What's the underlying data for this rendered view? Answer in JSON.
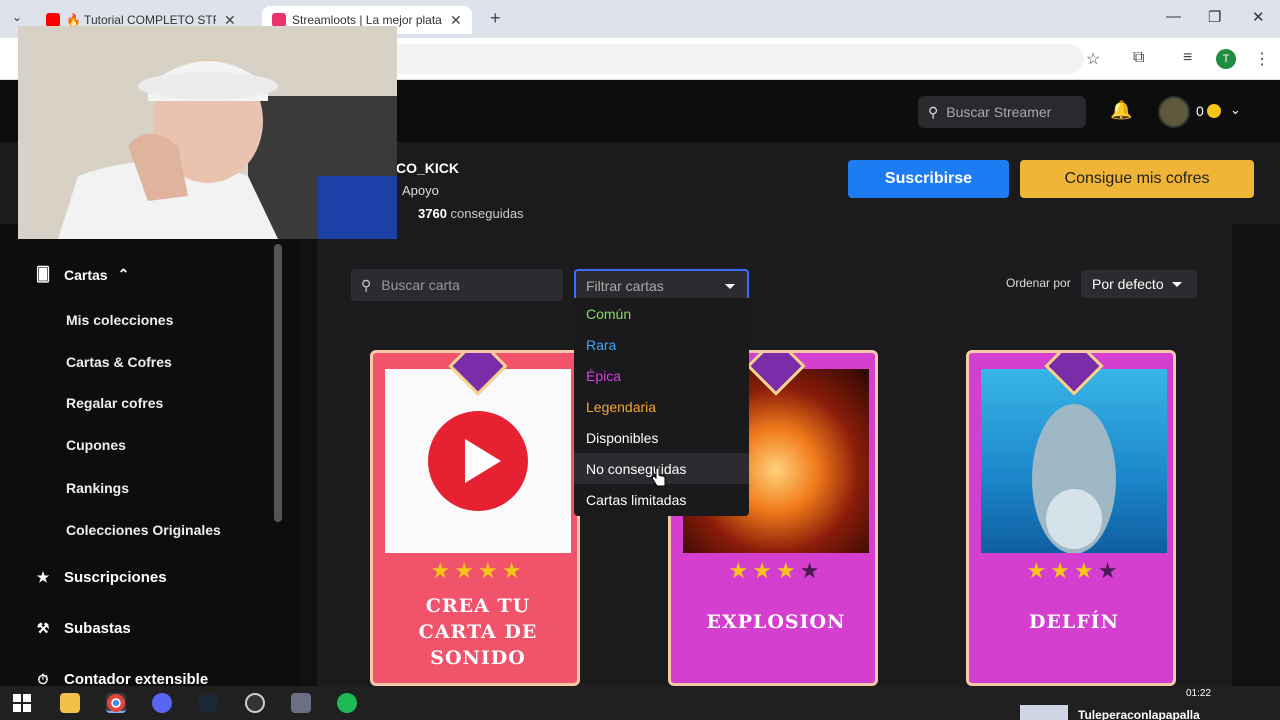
{
  "browser": {
    "tabs": [
      {
        "title": "🔥 Tutorial COMPLETO STREAM",
        "active": false
      },
      {
        "title": "Streamloots | La mejor plataform",
        "active": true
      }
    ]
  },
  "topnav": {
    "search_placeholder": "Buscar Streamer",
    "coins": "0"
  },
  "hero": {
    "name": "CO_KICK",
    "role": "Apoyo",
    "count": "3760",
    "count_suffix": "conseguidas",
    "subscribe_label": "Suscribirse",
    "chests_label": "Consigue mis cofres"
  },
  "sidebar": {
    "cards_section": "Cartas",
    "sub_items": [
      "Mis colecciones",
      "Cartas & Cofres",
      "Regalar cofres",
      "Cupones",
      "Rankings",
      "Colecciones Originales"
    ],
    "subscriptions": "Suscripciones",
    "auctions": "Subastas",
    "extensible_counter": "Contador extensible"
  },
  "toolbar": {
    "card_search_placeholder": "Buscar carta",
    "filter_placeholder": "Filtrar cartas",
    "sort_label": "Ordenar por",
    "sort_value": "Por defecto"
  },
  "filter_options": [
    {
      "label": "Común",
      "color": "#8bd96a"
    },
    {
      "label": "Rara",
      "color": "#3da7ff"
    },
    {
      "label": "Épica",
      "color": "#d43fe0"
    },
    {
      "label": "Legendaria",
      "color": "#f0a531"
    },
    {
      "label": "Disponibles",
      "color": "#ffffff"
    },
    {
      "label": "No conseguidas",
      "color": "#ffffff"
    },
    {
      "label": "Cartas limitadas",
      "color": "#ffffff"
    }
  ],
  "cards": [
    {
      "name_line1": "CREA TU",
      "name_line2": "CARTA DE",
      "name_line3": "SONIDO",
      "stars": 4
    },
    {
      "name_line1": "EXPLOSION",
      "stars": 3
    },
    {
      "name_line1": "DELFÍN",
      "stars": 3
    }
  ],
  "taskbar": {
    "time": "01:22",
    "notification_user": "Tuleperaconlapapalla"
  }
}
